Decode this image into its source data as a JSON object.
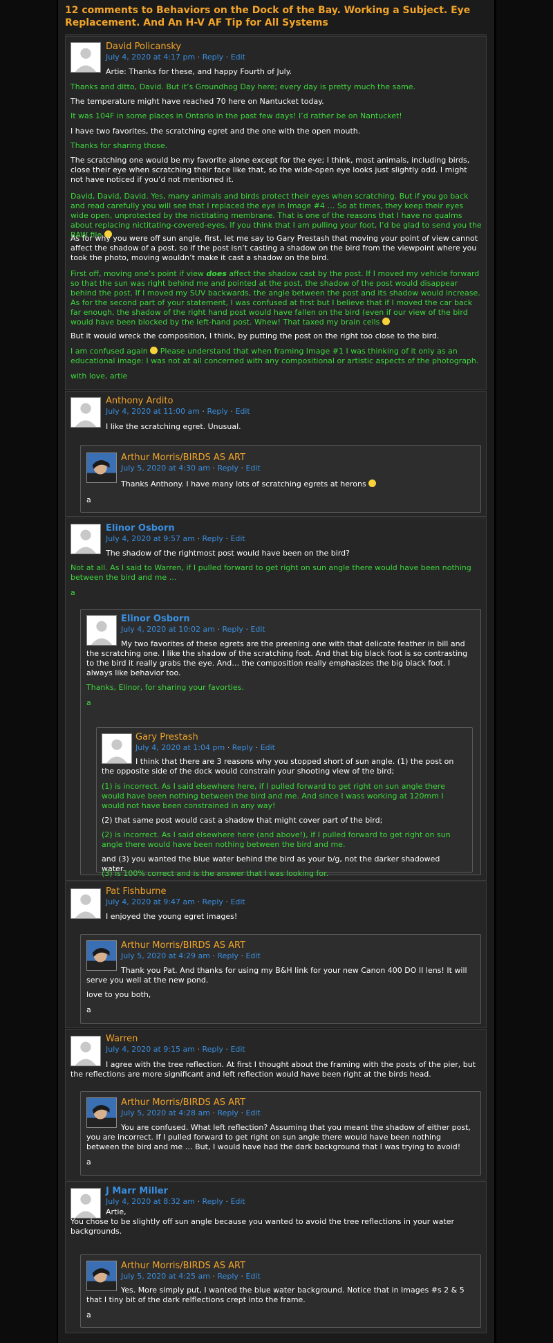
{
  "header": {
    "title": "12 comments to Behaviors on the Dock of the Bay. Working a Subject. Eye Replacement. And An H-V AF Tip for All Systems"
  },
  "actions": {
    "reply": "Reply",
    "edit": "Edit",
    "separator": "·"
  },
  "c1": {
    "author": "David Policansky",
    "date": "July 4, 2020 at 4:17 pm",
    "p1": "Artie: Thanks for these, and happy Fourth of July.",
    "p2": "Thanks and ditto, David. But it’s Groundhog Day here; every day is pretty much the same.",
    "p3": "The temperature might have reached 70 here on Nantucket today.",
    "p4": "It was 104F in some places in Ontario in the past few days! I’d rather be on Nantucket!",
    "p5": "I have two favorites, the scratching egret and the one with the open mouth.",
    "p6": "Thanks for sharing those.",
    "p7": "The scratching one would be my favorite alone except for the eye; I think, most animals, including birds, close their eye when scratching their face like that, so the wide-open eye looks just slightly odd. I might not have noticed if you’d not mentioned it.",
    "p8": "David, David, David. Yes, many animals and birds protect their eyes when scratching. But if you go back and read carefully you will see that I replaced the eye in Image #4 … So at times, they keep their eyes wide open, unprotected by the nictitating membrane. That is one of the reasons that I have no qualms about replacing nictitating-covered-eyes. If you think that I am pulling your foot, I’d be glad to send you the RAW file",
    "p9": "As for why you were off sun angle, first, let me say to Gary Prestash that moving your point of view cannot affect the shadow of a post, so if the post isn’t casting a shadow on the bird from the viewpoint where you took the photo, moving wouldn’t make it cast a shadow on the bird.",
    "p10a": "First off, moving one’s point if view",
    "p10em": "does",
    "p10b": "affect the shadow cast by the post. If I moved my vehicle forward so that the sun was right behind me and pointed at the post, the shadow of the post would disappear behind the post. If I moved my SUV backwards, the angle between the post and its shadow would increase. As for the second part of your statement, I was confused at first but I believe that if I moved the car back far enough, the shadow of the right hand post would have fallen on the bird (even if our view of the bird would have been blocked by the left-hand post. Whew! That taxed my brain cells",
    "p11": "But it would wreck the composition, I think, by putting the post on the right too close to the bird.",
    "p12a": "I am confused again",
    "p12b": "Please understand that when framing Image #1 I was thinking of it only as an educational image: I was not at all concerned with any compositional or artistic aspects of the photograph.",
    "p13": "with love, artie"
  },
  "c2": {
    "author": "Anthony Ardito",
    "date": "July 4, 2020 at 11:00 am",
    "p1": "I like the scratching egret. Unusual.",
    "r": {
      "author": "Arthur Morris/BIRDS AS ART",
      "date": "July 5, 2020 at 4:30 am",
      "p1": "Thanks Anthony. I have many lots of scratching egrets at herons",
      "p2": "a"
    }
  },
  "c3": {
    "author": "Elinor Osborn",
    "date": "July 4, 2020 at 9:57 am",
    "p1": "The shadow of the rightmost post would have been on the bird?",
    "p2": "Not at all. As I said to Warren, if I pulled forward to get right on sun angle there would have been nothing between the bird and me …",
    "p3": "a",
    "r": {
      "author": "Elinor Osborn",
      "date": "July 4, 2020 at 10:02 am",
      "p1": "My two favorites of these egrets are the preening one with that delicate feather in bill and the scratching one. I like the shadow of the scratching foot. And that big black foot is so contrasting to the bird it really grabs the eye. And… the composition really emphasizes the big black foot. I always like behavior too.",
      "p2": "Thanks, Elinor, for sharing your favorties.",
      "p3": "a"
    },
    "r2": {
      "author": "Gary Prestash",
      "date": "July 4, 2020 at 1:04 pm",
      "p1": "I think that there are 3 reasons why you stopped short of sun angle. (1) the post on the opposite side of the dock would constrain your shooting view of the bird;",
      "p2": "(1) is incorrect. As I said elsewhere here, if I pulled forward to get right on sun angle there would have been nothing between the bird and me. And since I wass working at 120mm I would not have been constrained in any way!",
      "p3": "(2) that same post would cast a shadow that might cover part of the bird;",
      "p4": "(2) is incorrect. As I said elsewhere here (and above!), if I pulled forward to get right on sun angle there would have been nothing between the bird and me.",
      "p5": "and (3) you wanted the blue water behind the bird as your b/g, not the darker shadowed water.",
      "p6": "(3) is 100% correct and is the answer that I was looking for."
    }
  },
  "c4": {
    "author": "Pat Fishburne",
    "date": "July 4, 2020 at 9:47 am",
    "p1": "I enjoyed the young egret images!",
    "r": {
      "author": "Arthur Morris/BIRDS AS ART",
      "date": "July 5, 2020 at 4:29 am",
      "p1": "Thank you Pat. And thanks for using my B&H link for your new Canon 400 DO II lens! It will serve you well at the new pond.",
      "p2": "love to you both,",
      "p3": "a"
    }
  },
  "c5": {
    "author": "Warren",
    "date": "July 4, 2020 at 9:15 am",
    "p1": "I agree with the tree reflection. At first I thought about the framing with the posts of the pier, but the reflections are more significant and left reflection would have been right at the birds head.",
    "r": {
      "author": "Arthur Morris/BIRDS AS ART",
      "date": "July 5, 2020 at 4:28 am",
      "p1": "You are confused. What left reflection? Assuming that you meant the shadow of either post, you are incorrect. If I pulled forward to get right on sun angle there would have been nothing between the bird and me … But, I would have had the dark background that I was trying to avoid!",
      "p2": "a"
    }
  },
  "c6": {
    "author": "J Marr Miller",
    "date": "July 4, 2020 at 8:32 am",
    "p1": "Artie,",
    "p2": "You chose to be slightly off sun angle because you wanted to avoid the tree reflections in your water backgrounds.",
    "r": {
      "author": "Arthur Morris/BIRDS AS ART",
      "date": "July 5, 2020 at 4:25 am",
      "p1": "Yes. More simply put, I wanted the blue water background. Notice that in Images #s 2 & 5 that I tiny bit of the dark relflections crept into the frame.",
      "p2": "a"
    }
  }
}
